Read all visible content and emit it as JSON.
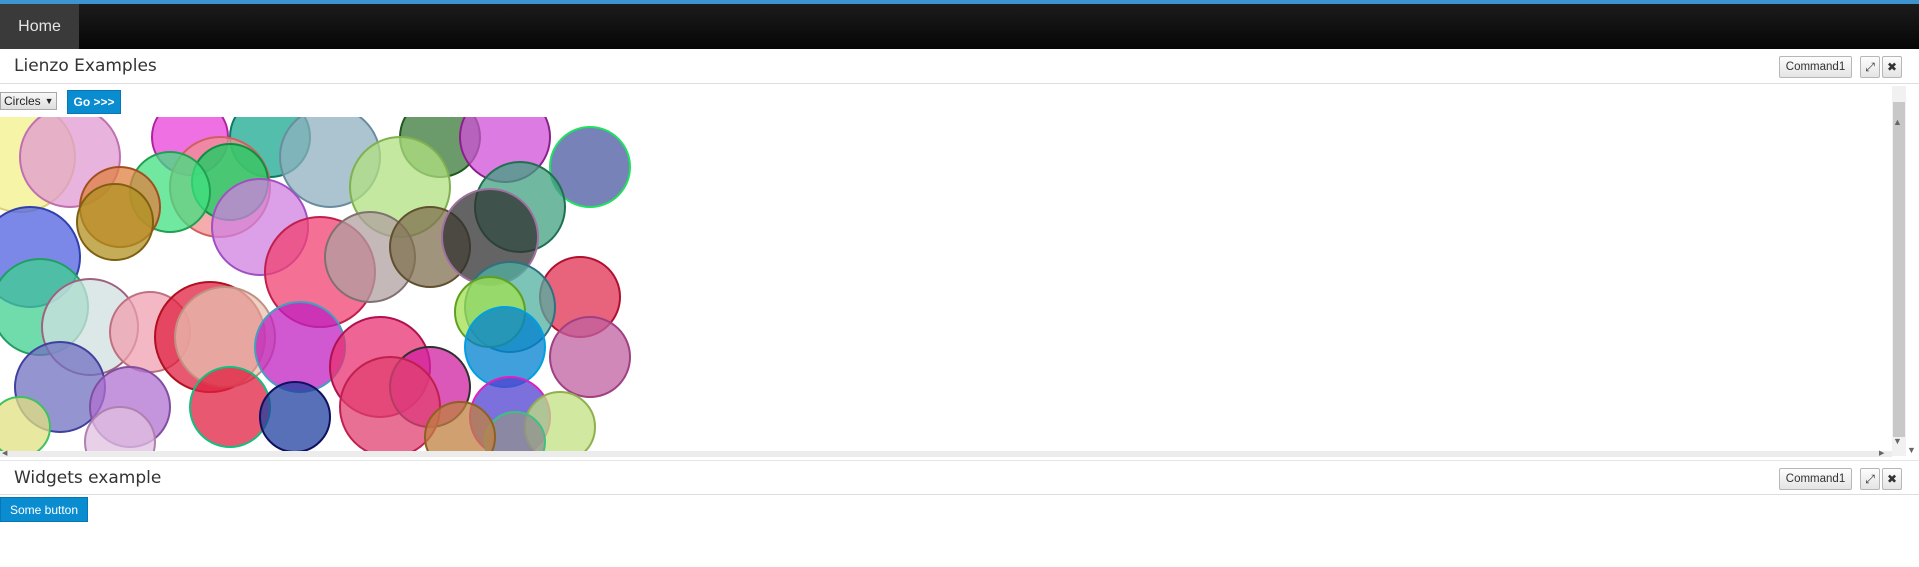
{
  "nav": {
    "home_label": "Home"
  },
  "lienzo_panel": {
    "title": "Lienzo Examples",
    "command_label": "Command1",
    "maximize_icon": "⤢",
    "close_icon": "✖",
    "select_value": "Circles",
    "select_arrow": "▼",
    "go_label": "Go >>>"
  },
  "widgets_panel": {
    "title": "Widgets example",
    "command_label": "Command1",
    "maximize_icon": "⤢",
    "close_icon": "✖",
    "button_label": "Some button"
  },
  "scrollbar": {
    "up": "▲",
    "down": "▼",
    "left": "◀",
    "right": "▶"
  },
  "colors": {
    "accent": "#3e94cf",
    "button_blue": "#0a8cd0"
  }
}
